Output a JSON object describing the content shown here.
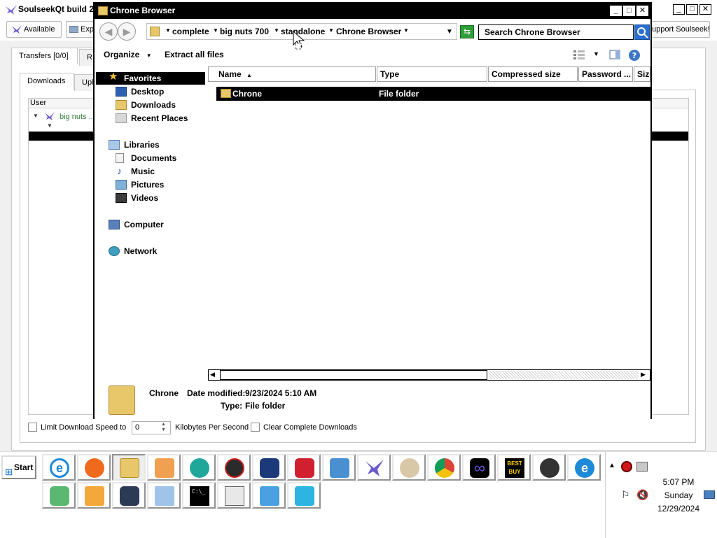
{
  "background_app": {
    "title": "SoulseekQt build 2",
    "status_button": "Available",
    "explore_button": "Exp",
    "support_button": "upport Soulseek!",
    "tabs": [
      "Transfers [0/0]",
      "R"
    ],
    "subtabs": [
      "Downloads",
      "Upl"
    ],
    "table_header": "User",
    "tree_user": "big nuts ..",
    "limit_label": "Limit Download Speed to",
    "limit_value": "0",
    "limit_unit": "Kilobytes Per Second",
    "clear_label": "Clear Complete Downloads"
  },
  "dialog": {
    "title": "Chrone Browser",
    "breadcrumbs": [
      "complete",
      "big nuts 700",
      "standalone",
      "Chrone Browser"
    ],
    "search_placeholder": "Search Chrone Browser",
    "commands": {
      "organize": "Organize",
      "extract": "Extract all files"
    },
    "nav": {
      "favorites": "Favorites",
      "favorites_items": [
        "Desktop",
        "Downloads",
        "Recent Places"
      ],
      "libraries": "Libraries",
      "libraries_items": [
        "Documents",
        "Music",
        "Pictures",
        "Videos"
      ],
      "computer": "Computer",
      "network": "Network"
    },
    "columns": [
      "Name",
      "Type",
      "Compressed size",
      "Password ...",
      "Size"
    ],
    "files": [
      {
        "name": "Chrone",
        "type": "File folder"
      }
    ],
    "details": {
      "name": "Chrone",
      "date_label": "Date modified:",
      "date_value": "9/23/2024 5:10 AM",
      "type_label": "Type:",
      "type_value": "File folder"
    }
  },
  "taskbar": {
    "start_label": "Start",
    "icons_row1": [
      "internet-explorer",
      "firefox",
      "file-explorer",
      "media-player",
      "app-teal",
      "security-app",
      "shield-app",
      "video-recorder",
      "control-panel",
      "soulseek",
      "paint",
      "chrome",
      "infinity-app",
      "best-buy",
      "blackberry",
      "internet-explorer-2"
    ],
    "icons_row2": [
      "cube-app",
      "slides-app",
      "tiles-app",
      "documents",
      "command-prompt",
      "window-app",
      "send-app",
      "recycle-bin"
    ],
    "best_buy_label": "BEST BUY",
    "cmd_label": "C:\\_",
    "clock": {
      "time": "5:07 PM",
      "day": "Sunday",
      "date": "12/29/2024"
    }
  },
  "colors": {
    "selection": "#000000",
    "accent": "#2a6ed0",
    "folder": "#e8c66a"
  }
}
